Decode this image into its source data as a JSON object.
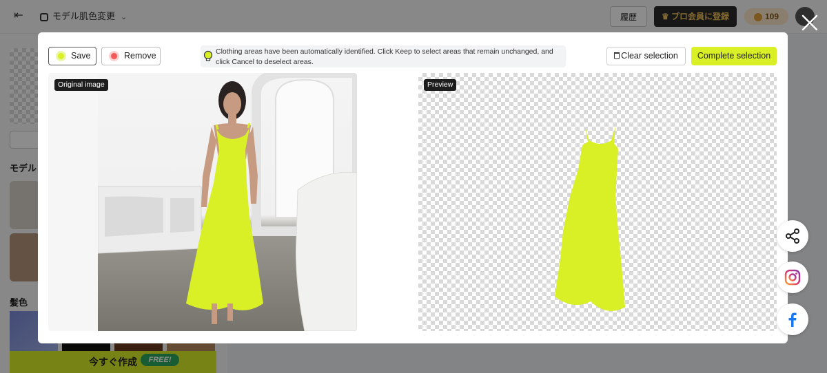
{
  "header": {
    "back_icon": "exit-icon",
    "app_title": "モデル肌色変更",
    "history_label": "履歴",
    "pro_label": "プロ会員に登録",
    "coins": "109"
  },
  "left_panel": {
    "model_label": "モデル",
    "hair_label": "髪色",
    "create_label": "今すぐ作成",
    "free_badge": "FREE!"
  },
  "modal": {
    "save_label": "Save",
    "remove_label": "Remove",
    "hint": "Clothing areas have been automatically identified. Click Keep to select areas that remain unchanged, and click Cancel to deselect areas.",
    "clear_label": "Clear selection",
    "complete_label": "Complete selection",
    "original_tag": "Original image",
    "preview_tag": "Preview"
  },
  "colors": {
    "accent": "#d9f027",
    "remove_red": "#f25a5a",
    "overlay": "rgba(0,0,0,0.45)"
  },
  "side_actions": [
    "share-icon",
    "instagram-icon",
    "facebook-icon"
  ]
}
